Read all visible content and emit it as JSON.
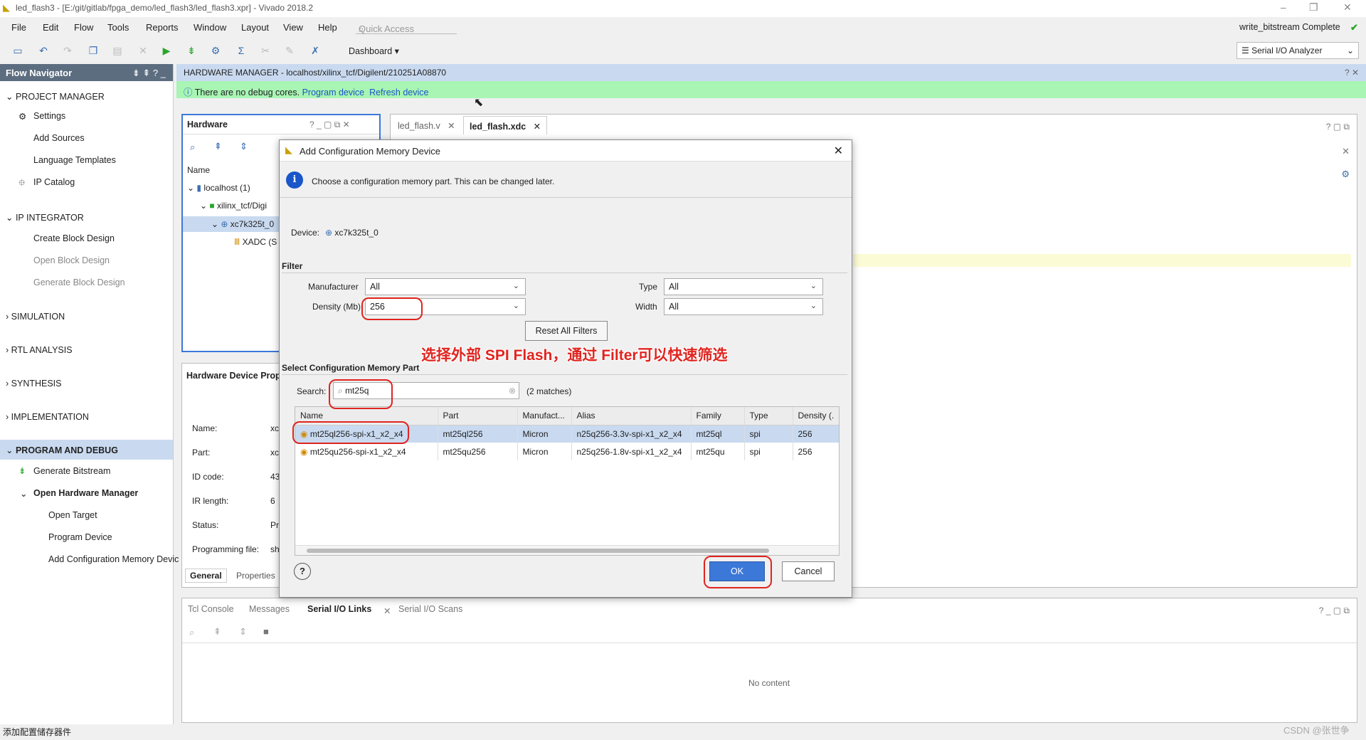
{
  "titlebar": {
    "title": "led_flash3 - [E:/git/gitlab/fpga_demo/led_flash3/led_flash3.xpr] - Vivado 2018.2",
    "minimize": "–",
    "restore": "❐",
    "close": "✕"
  },
  "menu": {
    "items": [
      "File",
      "Edit",
      "Flow",
      "Tools",
      "Reports",
      "Window",
      "Layout",
      "View",
      "Help"
    ],
    "quick_access": "Quick Access",
    "status": "write_bitstream Complete",
    "dashboard": "Dashboard",
    "layout_select": "Serial I/O Analyzer"
  },
  "flow_nav": {
    "title": "Flow Navigator",
    "project_manager": "PROJECT MANAGER",
    "pm_items": [
      "Settings",
      "Add Sources",
      "Language Templates",
      "IP Catalog"
    ],
    "ip_integrator": "IP INTEGRATOR",
    "ipi_items": [
      "Create Block Design",
      "Open Block Design",
      "Generate Block Design"
    ],
    "simulation": "SIMULATION",
    "rtl": "RTL ANALYSIS",
    "synthesis": "SYNTHESIS",
    "implementation": "IMPLEMENTATION",
    "program_debug": "PROGRAM AND DEBUG",
    "pd_items": [
      "Generate Bitstream",
      "Open Hardware Manager",
      "Open Target",
      "Program Device",
      "Add Configuration Memory Devic"
    ]
  },
  "hw_manager": {
    "header": "HARDWARE MANAGER - localhost/xilinx_tcf/Digilent/210251A08870",
    "banner_text": "There are no debug cores.",
    "program_link": "Program device",
    "refresh_link": "Refresh device"
  },
  "hardware_panel": {
    "title": "Hardware",
    "col_name": "Name",
    "rows": [
      "localhost (1)",
      "xilinx_tcf/Digi",
      "xc7k325t_0",
      "XADC (S"
    ]
  },
  "props_panel": {
    "title": "Hardware Device Prope",
    "labels": [
      "Name:",
      "Part:",
      "ID code:",
      "IR length:",
      "Status:",
      "Programming file:"
    ],
    "values": [
      "xc",
      "xc",
      "43",
      "6",
      "Pr",
      "sh"
    ],
    "tab_general": "General",
    "tab_properties": "Properties"
  },
  "editor_tabs": [
    "led_flash.v",
    "led_flash.xdc"
  ],
  "dialog": {
    "title": "Add Configuration Memory Device",
    "info": "Choose a configuration memory part. This can be changed later.",
    "device_label": "Device:",
    "device": "xc7k325t_0",
    "filter": "Filter",
    "manufacturer_label": "Manufacturer",
    "manufacturer": "All",
    "density_label": "Density (Mb)",
    "density": "256",
    "type_label": "Type",
    "type": "All",
    "width_label": "Width",
    "width": "All",
    "reset": "Reset All Filters",
    "select_label": "Select Configuration Memory Part",
    "search_label": "Search:",
    "search": "mt25q",
    "matches": "(2 matches)",
    "columns": [
      "Name",
      "Part",
      "Manufact...",
      "Alias",
      "Family",
      "Type",
      "Density (."
    ],
    "rows": [
      [
        "mt25ql256-spi-x1_x2_x4",
        "mt25ql256",
        "Micron",
        "n25q256-3.3v-spi-x1_x2_x4",
        "mt25ql",
        "spi",
        "256"
      ],
      [
        "mt25qu256-spi-x1_x2_x4",
        "mt25qu256",
        "Micron",
        "n25q256-1.8v-spi-x1_x2_x4",
        "mt25qu",
        "spi",
        "256"
      ]
    ],
    "ok": "OK",
    "cancel": "Cancel",
    "help": "?"
  },
  "annotation": "选择外部 SPI Flash，通过 Filter可以快速筛选",
  "bottom": {
    "tabs": [
      "Tcl Console",
      "Messages",
      "Serial I/O Links",
      "Serial I/O Scans"
    ],
    "empty": "No content"
  },
  "statusbar": {
    "text": "添加配置储存器件",
    "watermark": "CSDN @张世争"
  },
  "colors": {
    "accent": "#3c78d8",
    "banner": "#a8f5b4",
    "header": "#c9daf0",
    "annotation": "#e0241f"
  }
}
